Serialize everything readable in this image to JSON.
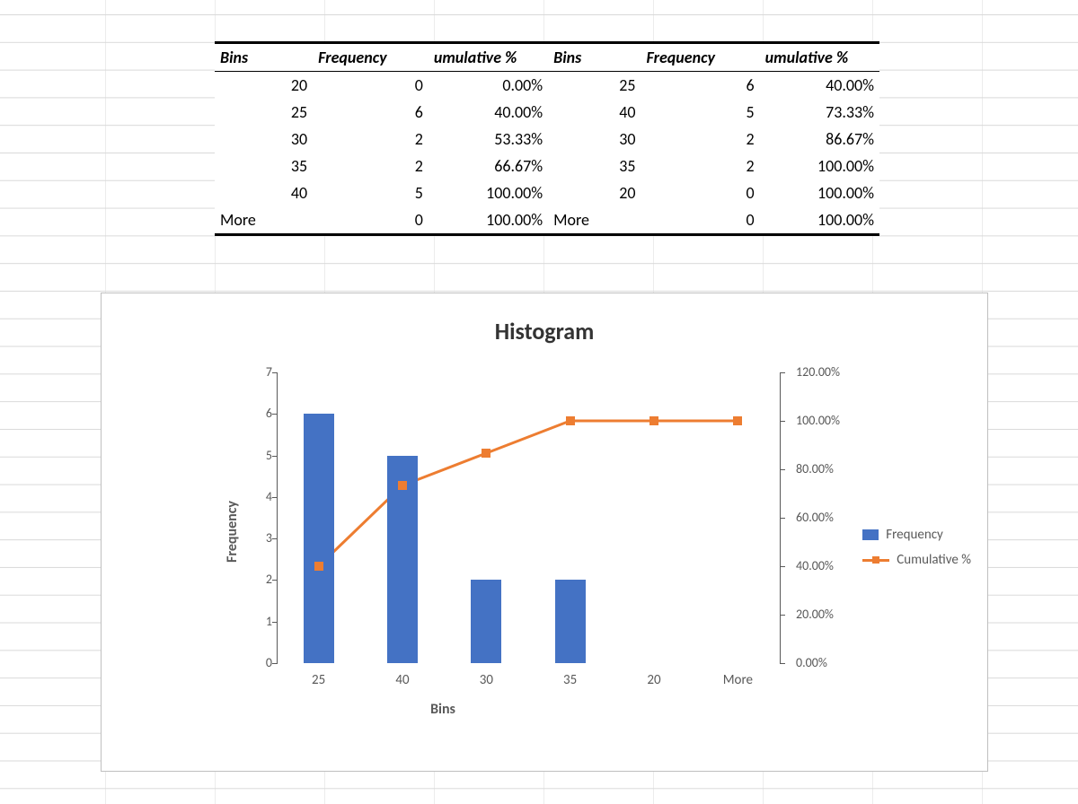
{
  "table": {
    "headers": {
      "bins1": "Bins",
      "freq1": "Frequency",
      "cum1": "umulative %",
      "bins2": "Bins",
      "freq2": "Frequency",
      "cum2": "umulative %"
    },
    "rows": [
      {
        "b1": "20",
        "f1": "0",
        "c1": "0.00%",
        "b2": "25",
        "f2": "6",
        "c2": "40.00%"
      },
      {
        "b1": "25",
        "f1": "6",
        "c1": "40.00%",
        "b2": "40",
        "f2": "5",
        "c2": "73.33%"
      },
      {
        "b1": "30",
        "f1": "2",
        "c1": "53.33%",
        "b2": "30",
        "f2": "2",
        "c2": "86.67%"
      },
      {
        "b1": "35",
        "f1": "2",
        "c1": "66.67%",
        "b2": "35",
        "f2": "2",
        "c2": "100.00%"
      },
      {
        "b1": "40",
        "f1": "5",
        "c1": "100.00%",
        "b2": "20",
        "f2": "0",
        "c2": "100.00%"
      },
      {
        "b1": "More",
        "f1": "0",
        "c1": "100.00%",
        "b2": "More",
        "f2": "0",
        "c2": "100.00%"
      }
    ]
  },
  "chart_data": {
    "type": "bar",
    "title": "Histogram",
    "xlabel": "Bins",
    "ylabel": "Frequency",
    "categories": [
      "25",
      "40",
      "30",
      "35",
      "20",
      "More"
    ],
    "series": [
      {
        "name": "Frequency",
        "type": "bar",
        "axis": "left",
        "values": [
          6,
          5,
          2,
          2,
          0,
          0
        ]
      },
      {
        "name": "Cumulative %",
        "type": "line",
        "axis": "right",
        "values": [
          40.0,
          73.33,
          86.67,
          100.0,
          100.0,
          100.0
        ]
      }
    ],
    "y_left": {
      "min": 0,
      "max": 7,
      "ticks": [
        "0",
        "1",
        "2",
        "3",
        "4",
        "5",
        "6",
        "7"
      ]
    },
    "y_right": {
      "min": 0,
      "max": 120,
      "ticks": [
        "0.00%",
        "20.00%",
        "40.00%",
        "60.00%",
        "80.00%",
        "100.00%",
        "120.00%"
      ]
    },
    "colors": {
      "bar": "#4472c4",
      "line": "#ed7d31"
    }
  },
  "legend": {
    "freq": "Frequency",
    "cum": "Cumulative %"
  }
}
